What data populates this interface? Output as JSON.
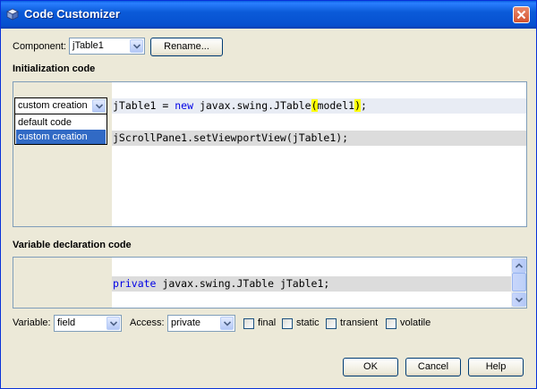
{
  "window": {
    "title": "Code Customizer"
  },
  "component": {
    "label": "Component:",
    "value": "jTable1",
    "rename_label": "Rename..."
  },
  "init": {
    "heading": "Initialization code",
    "mode_value": "custom creation",
    "mode_options": [
      "default code",
      "custom creation"
    ],
    "selected_option": "custom creation",
    "line1": {
      "pre": "jTable1 = ",
      "kw": "new",
      "mid": " javax.swing.JTable",
      "open": "(",
      "arg": "model1",
      "close": ")",
      "post": ";"
    },
    "line2": "jScrollPane1.setViewportView(jTable1);"
  },
  "vardecl": {
    "heading": "Variable declaration code",
    "kw": "private",
    "rest": " javax.swing.JTable jTable1;"
  },
  "options": {
    "variable_label": "Variable:",
    "variable_value": "field",
    "access_label": "Access:",
    "access_value": "private",
    "final_label": "final",
    "static_label": "static",
    "transient_label": "transient",
    "volatile_label": "volatile"
  },
  "buttons": {
    "ok": "OK",
    "cancel": "Cancel",
    "help": "Help"
  },
  "icons": {
    "title": "cube-icon",
    "close": "close-icon"
  },
  "colors": {
    "titlebar": "#0a5fe0",
    "selection": "#316ac5",
    "keyword": "#0000e6",
    "bracket_highlight": "#ffff00"
  }
}
